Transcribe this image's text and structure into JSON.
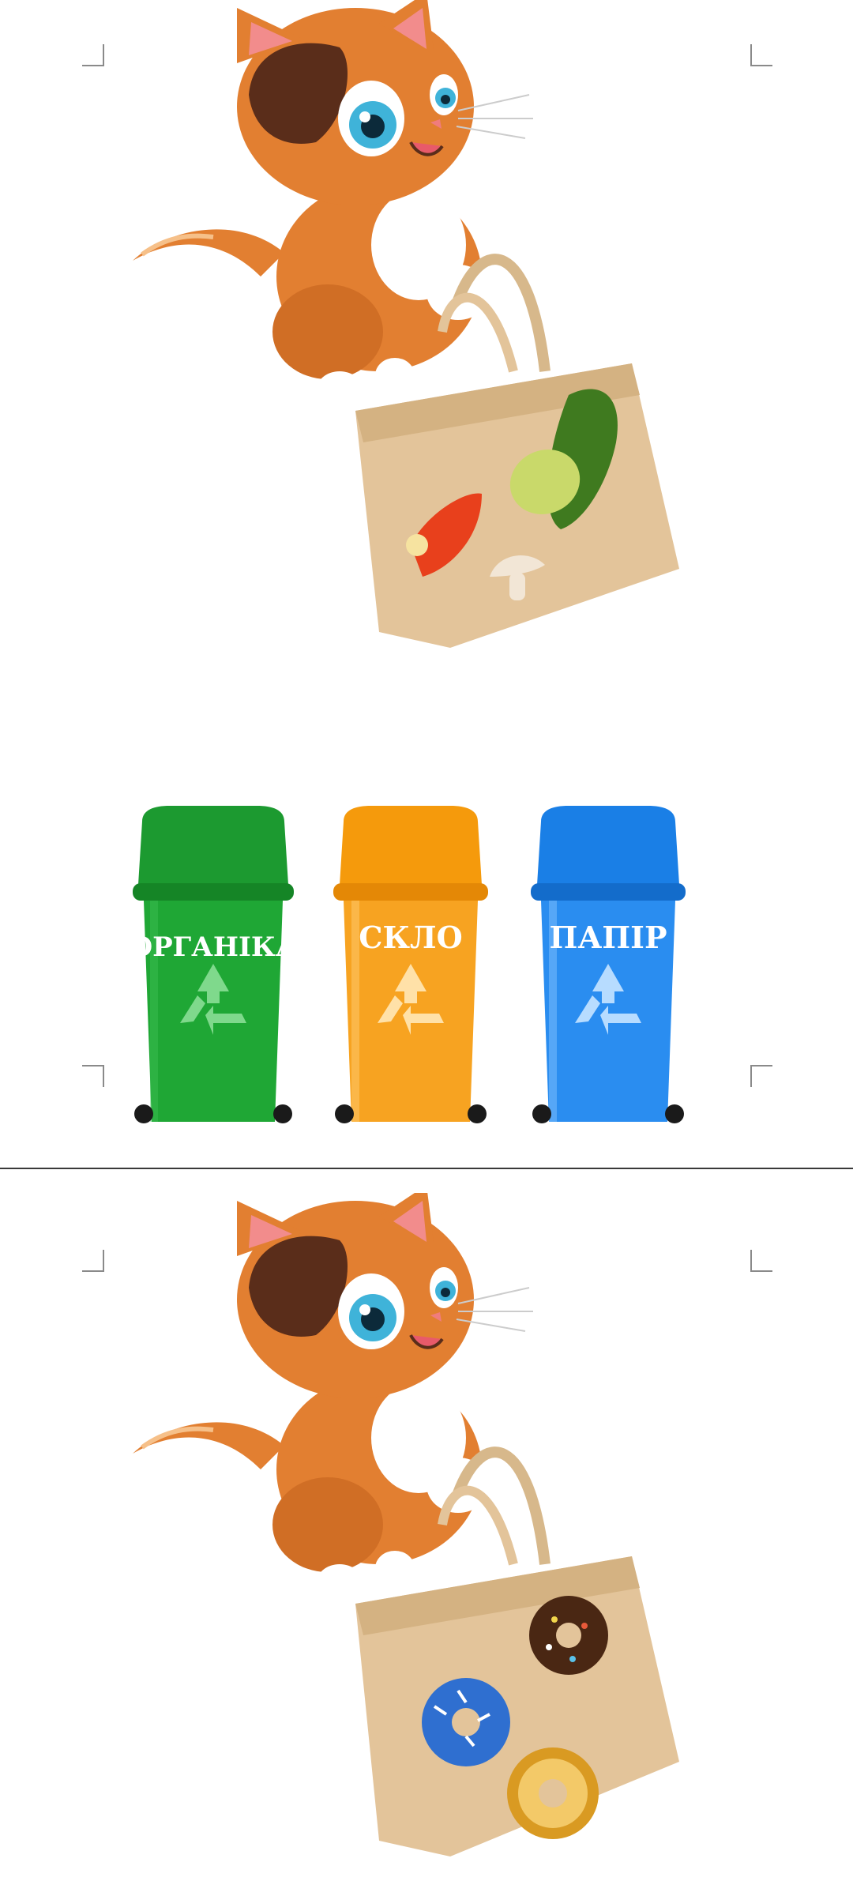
{
  "pages": [
    {
      "illustration": {
        "character": "orange-kitten",
        "bag_items": [
          "red-pepper",
          "zucchini",
          "mushroom"
        ]
      },
      "bins": [
        {
          "label": "ОРГАНІКА",
          "color": "#1a9a2e",
          "icon": "recycle-icon"
        },
        {
          "label": "СКЛО",
          "color": "#f59a0c",
          "icon": "recycle-icon"
        },
        {
          "label": "ПАПІР",
          "color": "#1a7fe6",
          "icon": "recycle-icon"
        }
      ]
    },
    {
      "illustration": {
        "character": "orange-kitten",
        "bag_items": [
          "chocolate-donut",
          "blue-donut",
          "glazed-donut"
        ]
      }
    }
  ],
  "colors": {
    "cat_fur": "#e27f31",
    "cat_dark": "#5a2d1a",
    "bag": "#e3c49a",
    "page_border": "#8a8a8a"
  }
}
